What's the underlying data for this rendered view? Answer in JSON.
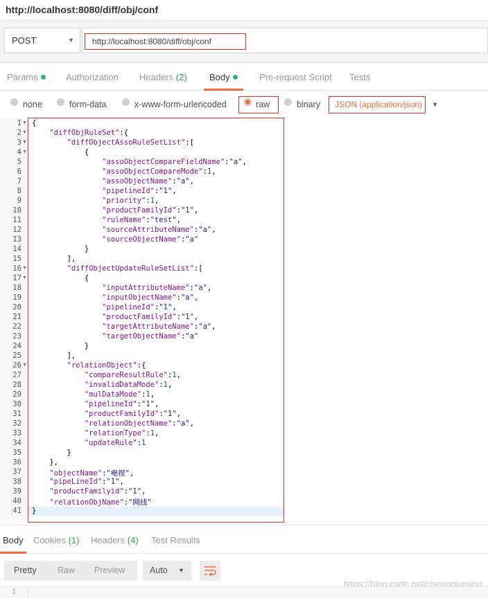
{
  "window": {
    "title": "http://localhost:8080/diff/obj/conf"
  },
  "request": {
    "method": "POST",
    "url": "http://localhost:8080/diff/obj/conf"
  },
  "tabs": {
    "params": "Params",
    "authorization": "Authorization",
    "headers": "Headers",
    "headers_count": "(2)",
    "body": "Body",
    "prerequest": "Pre-request Script",
    "tests": "Tests"
  },
  "body_types": {
    "none": "none",
    "form_data": "form-data",
    "urlencoded": "x-www-form-urlencoded",
    "raw": "raw",
    "binary": "binary",
    "content_type": "JSON (application/json)"
  },
  "code_lines": [
    "{",
    "    \"diffObjRuleSet\":{",
    "        \"diffObjectAssoRuleSetList\":[",
    "            {",
    "                \"assoObjectCompareFieldName\":\"a\",",
    "                \"assoObjectCompareMode\":1,",
    "                \"assoObjectName\":\"a\",",
    "                \"pipelineId\":\"1\",",
    "                \"priority\":1,",
    "                \"productFamilyId\":\"1\",",
    "                \"ruleName\":\"test\",",
    "                \"sourceAttributeName\":\"a\",",
    "                \"sourceObjectName\":\"a\"",
    "            }",
    "        ],",
    "        \"diffObjectUpdateRuleSetList\":[",
    "            {",
    "                \"inputAttributeName\":\"a\",",
    "                \"inputObjectName\":\"a\",",
    "                \"pipelineId\":\"1\",",
    "                \"productFamilyId\":\"1\",",
    "                \"targetAttributeName\":\"a\",",
    "                \"targetObjectName\":\"a\"",
    "            }",
    "        ],",
    "        \"relationObject\":{",
    "            \"compareResultRule\":1,",
    "            \"invalidDataMode\":1,",
    "            \"mulDataMode\":1,",
    "            \"pipelineId\":\"1\",",
    "            \"productFamilyId\":\"1\",",
    "            \"relationObjectName\":\"a\",",
    "            \"relationType\":1,",
    "            \"updateRule\":1",
    "        }",
    "    },",
    "    \"objectName\":\"电视\",",
    "    \"pipeLineId\":\"1\",",
    "    \"productFamilyid\":\"1\",",
    "    \"relationObjName\":\"网线\"",
    "}"
  ],
  "fold_lines": [
    1,
    2,
    3,
    4,
    16,
    17,
    26
  ],
  "active_line": 41,
  "response_tabs": {
    "body": "Body",
    "cookies": "Cookies",
    "cookies_count": "(1)",
    "headers": "Headers",
    "headers_count": "(4)",
    "test_results": "Test Results"
  },
  "view": {
    "pretty": "Pretty",
    "raw": "Raw",
    "preview": "Preview",
    "format": "Auto"
  },
  "response_first_line": "1",
  "watermark": "https://blog.csdn.net/chengqiuming",
  "colors": {
    "accent": "#f26b3a",
    "highlight_box": "#e0301e",
    "status_dot": "#30b36a",
    "key": "#881391",
    "string": "#1a1aa6"
  }
}
